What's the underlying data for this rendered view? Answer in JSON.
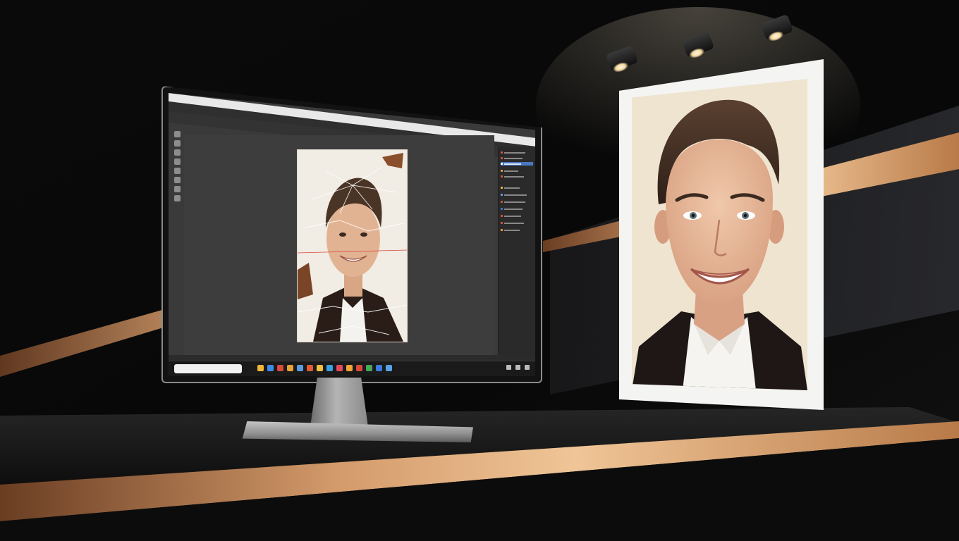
{
  "scene": {
    "background_color": "#050505",
    "accent_stripe_color": "#c98a5a",
    "table_color": "#141414"
  },
  "editor": {
    "canvas_color": "#3d3d3d",
    "panel_color": "#2a2a2a",
    "document_bg": "#f1ece4",
    "tool_icons": [
      "move-icon",
      "marquee-icon",
      "lasso-icon",
      "crop-icon",
      "eyedropper-icon",
      "brush-icon",
      "eraser-icon",
      "text-icon"
    ],
    "panel_icons": [
      "layer-icon",
      "adjust-icon",
      "mask-icon",
      "history-icon"
    ]
  },
  "taskbar": {
    "icons": [
      "folder-icon",
      "browser-icon",
      "mail-icon",
      "store-icon",
      "photo-icon",
      "settings-icon",
      "music-icon",
      "chat-icon",
      "video-icon",
      "note-icon",
      "calendar-icon",
      "maps-icon",
      "cloud-icon",
      "app-icon"
    ],
    "tray_icons": [
      "wifi-icon",
      "volume-icon",
      "battery-icon"
    ]
  },
  "print": {
    "frame_color": "#f4f4f2",
    "photo_bg": "#efe4d0"
  }
}
